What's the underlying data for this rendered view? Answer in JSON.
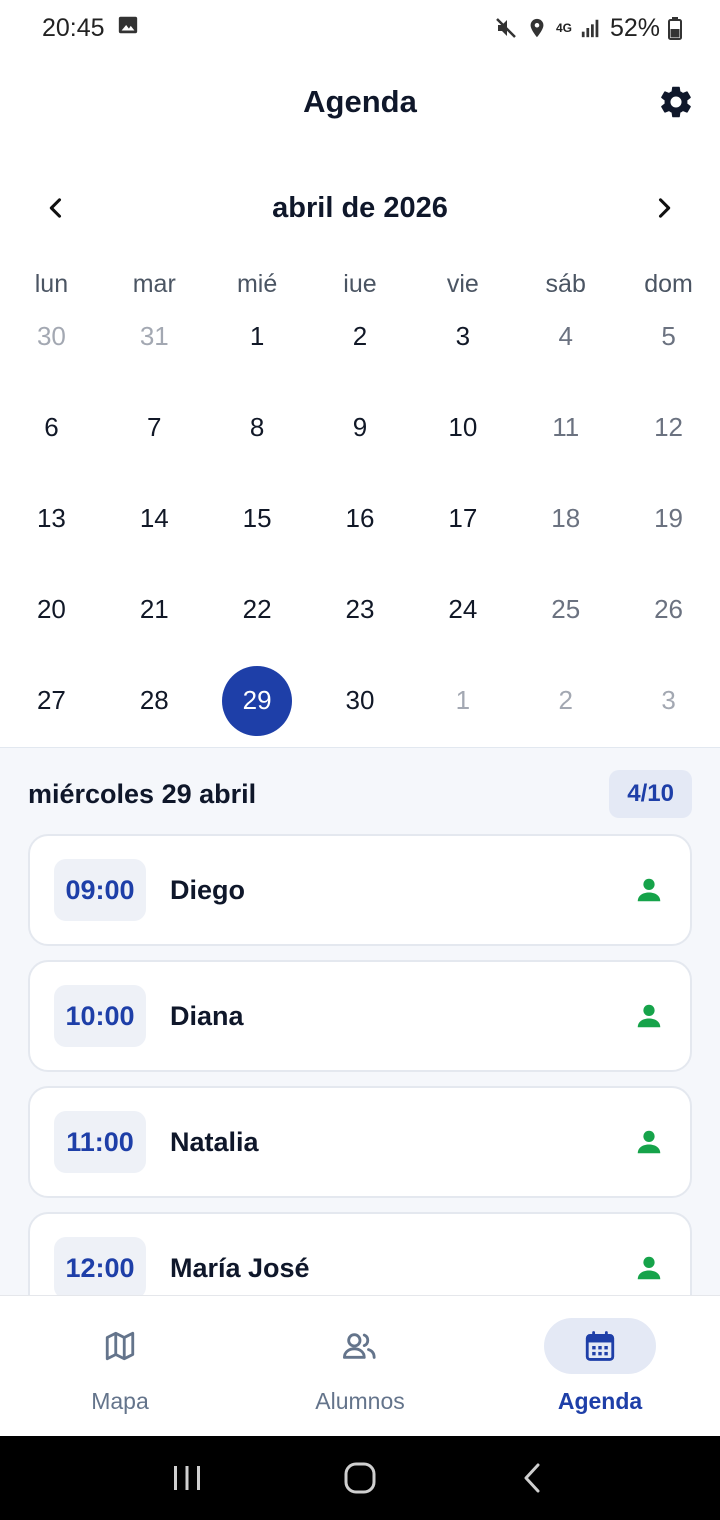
{
  "status_bar": {
    "time": "20:45",
    "network": "4G",
    "battery": "52%"
  },
  "header": {
    "title": "Agenda",
    "settings_icon": "gear-icon"
  },
  "calendar": {
    "month_label": "abril de 2026",
    "weekdays": [
      "lun",
      "mar",
      "mié",
      "iue",
      "vie",
      "sáb",
      "dom"
    ],
    "weeks": [
      [
        "30",
        "31",
        "1",
        "2",
        "3",
        "4",
        "5"
      ],
      [
        "6",
        "7",
        "8",
        "9",
        "10",
        "11",
        "12"
      ],
      [
        "13",
        "14",
        "15",
        "16",
        "17",
        "18",
        "19"
      ],
      [
        "20",
        "21",
        "22",
        "23",
        "24",
        "25",
        "26"
      ],
      [
        "27",
        "28",
        "29",
        "30",
        "1",
        "2",
        "3"
      ]
    ],
    "selected_day": "29"
  },
  "day_panel": {
    "title": "miércoles 29 abril",
    "count": "4/10",
    "appointments": [
      {
        "time": "09:00",
        "name": "Diego"
      },
      {
        "time": "10:00",
        "name": "Diana"
      },
      {
        "time": "11:00",
        "name": "Natalia"
      },
      {
        "time": "12:00",
        "name": "María José"
      }
    ]
  },
  "bottom_nav": {
    "items": [
      {
        "label": "Mapa",
        "icon": "map-icon"
      },
      {
        "label": "Alumnos",
        "icon": "people-icon"
      },
      {
        "label": "Agenda",
        "icon": "calendar-icon"
      }
    ],
    "active": "Agenda"
  },
  "colors": {
    "accent": "#1e3fa8",
    "status_green": "#16a34a",
    "panel_bg": "#f5f7fb"
  }
}
